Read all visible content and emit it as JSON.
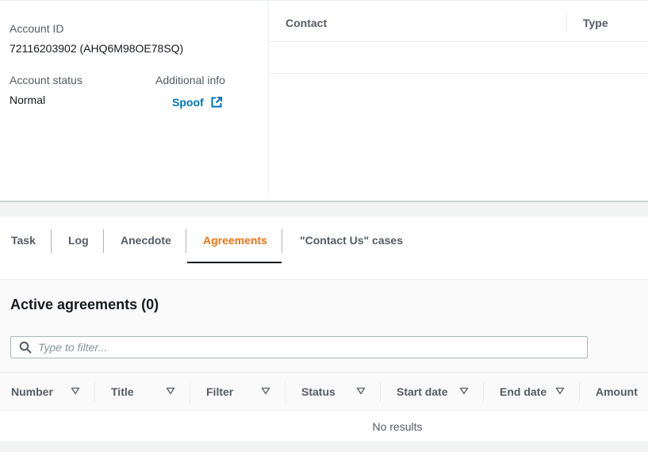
{
  "account": {
    "id_label": "Account ID",
    "id_value": "72116203902 (AHQ6M98OE78SQ)",
    "status_label": "Account status",
    "status_value": "Normal",
    "additional_label": "Additional info",
    "additional_link": "Spoof"
  },
  "contact_table": {
    "columns": [
      "Contact",
      "Type"
    ]
  },
  "tabs": [
    {
      "label": "Task",
      "active": false
    },
    {
      "label": "Log",
      "active": false
    },
    {
      "label": "Anecdote",
      "active": false
    },
    {
      "label": "Agreements",
      "active": true
    },
    {
      "label": "\"Contact Us\" cases",
      "active": false
    }
  ],
  "agreements": {
    "title": "Active agreements (0)",
    "filter_placeholder": "Type to filter...",
    "columns": [
      "Number",
      "Title",
      "Filter",
      "Status",
      "Start date",
      "End date",
      "Amount"
    ],
    "empty_text": "No results"
  },
  "colors": {
    "link": "#0073bb",
    "active_tab": "#ec7211",
    "text": "#16191f",
    "muted": "#545b64"
  }
}
